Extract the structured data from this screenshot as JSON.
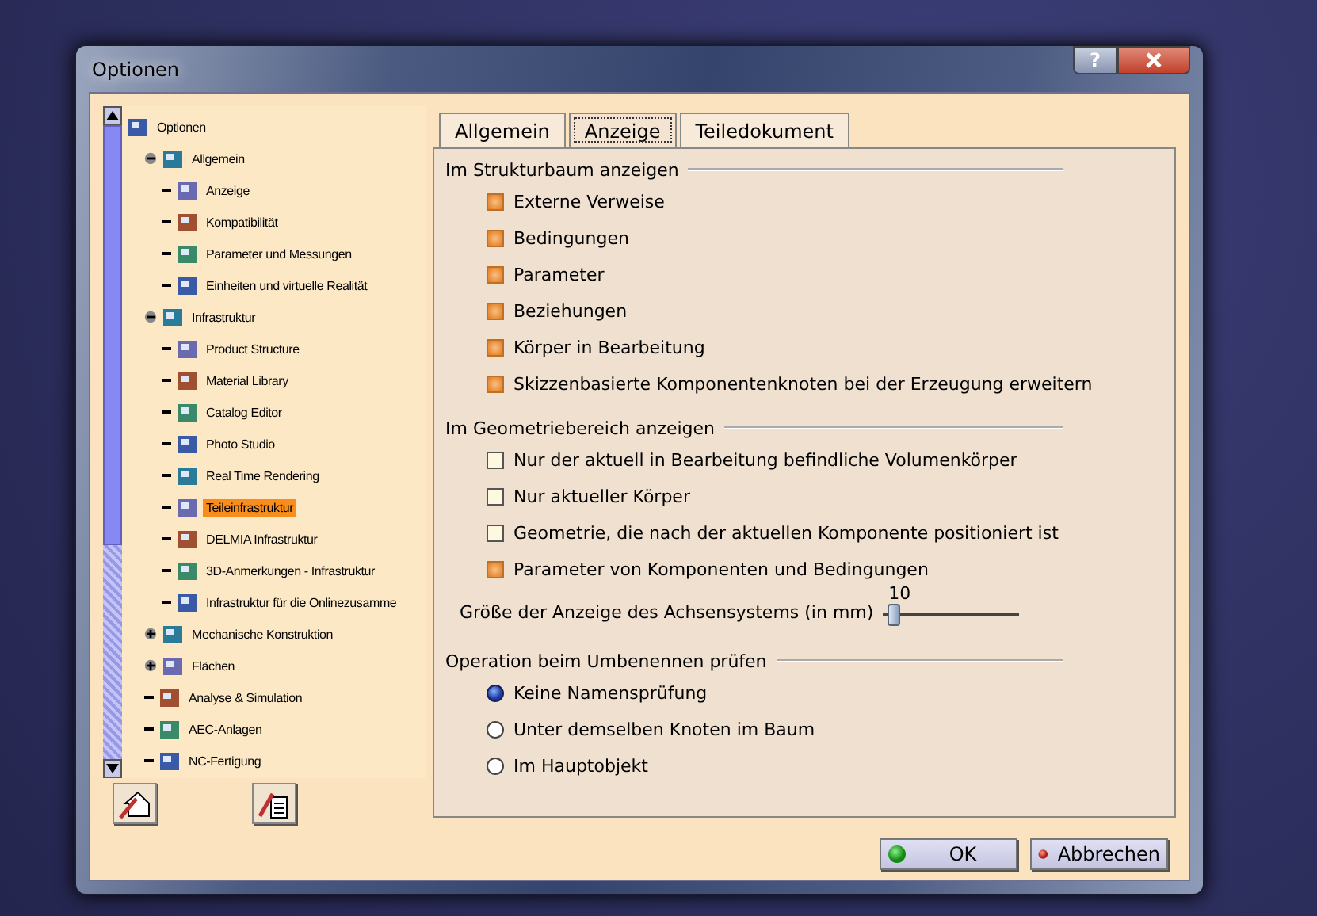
{
  "window": {
    "title": "Optionen",
    "help": "?"
  },
  "tree": {
    "items": [
      {
        "label": "Optionen",
        "selected": false,
        "children": [
          {
            "label": "Allgemein",
            "expanded": true,
            "selected": false,
            "children": [
              {
                "label": "Anzeige",
                "selected": false
              },
              {
                "label": "Kompatibilität",
                "selected": false
              },
              {
                "label": "Parameter und Messungen",
                "selected": false
              },
              {
                "label": "Einheiten und virtuelle Realität",
                "selected": false
              }
            ]
          },
          {
            "label": "Infrastruktur",
            "expanded": true,
            "selected": false,
            "children": [
              {
                "label": "Product Structure",
                "selected": false
              },
              {
                "label": "Material Library",
                "selected": false
              },
              {
                "label": "Catalog Editor",
                "selected": false
              },
              {
                "label": "Photo Studio",
                "selected": false
              },
              {
                "label": "Real Time Rendering",
                "selected": false
              },
              {
                "label": "Teileinfrastruktur",
                "selected": true
              },
              {
                "label": "DELMIA Infrastruktur",
                "selected": false
              },
              {
                "label": "3D-Anmerkungen - Infrastruktur",
                "selected": false
              },
              {
                "label": "Infrastruktur für die Onlinezusamme",
                "selected": false
              }
            ]
          },
          {
            "label": "Mechanische Konstruktion",
            "expanded": false,
            "selected": false
          },
          {
            "label": "Flächen",
            "expanded": false,
            "selected": false
          },
          {
            "label": "Analyse & Simulation",
            "selected": false
          },
          {
            "label": "AEC-Anlagen",
            "selected": false
          },
          {
            "label": "NC-Fertigung",
            "selected": false
          }
        ]
      }
    ]
  },
  "tabs": [
    {
      "label": "Allgemein",
      "selected": false
    },
    {
      "label": "Anzeige",
      "selected": true
    },
    {
      "label": "Teiledokument",
      "selected": false
    }
  ],
  "sections": [
    {
      "title": "Im Strukturbaum anzeigen",
      "rows": [
        {
          "kind": "checkbox",
          "label": "Externe Verweise",
          "checked": true
        },
        {
          "kind": "checkbox",
          "label": "Bedingungen",
          "checked": true
        },
        {
          "kind": "checkbox",
          "label": "Parameter",
          "checked": true
        },
        {
          "kind": "checkbox",
          "label": "Beziehungen",
          "checked": true
        },
        {
          "kind": "checkbox",
          "label": "Körper in Bearbeitung",
          "checked": true
        },
        {
          "kind": "checkbox",
          "label": "Skizzenbasierte Komponentenknoten bei der Erzeugung erweitern",
          "checked": true
        }
      ]
    },
    {
      "title": "Im Geometriebereich anzeigen",
      "rows": [
        {
          "kind": "checkbox",
          "label": "Nur der aktuell in Bearbeitung befindliche Volumenkörper",
          "checked": false
        },
        {
          "kind": "checkbox",
          "label": "Nur aktueller Körper",
          "checked": false
        },
        {
          "kind": "checkbox",
          "label": "Geometrie, die nach der aktuellen Komponente positioniert ist",
          "checked": false
        },
        {
          "kind": "checkbox",
          "label": "Parameter von Komponenten und Bedingungen",
          "checked": true
        },
        {
          "kind": "slider",
          "label": "Größe der Anzeige des Achsensystems (in mm)",
          "reading": "10",
          "level": 0.04
        }
      ]
    },
    {
      "title": "Operation beim Umbenennen prüfen",
      "rows": [
        {
          "kind": "radio",
          "label": "Keine Namensprüfung",
          "selected": true
        },
        {
          "kind": "radio",
          "label": "Unter demselben Knoten im Baum",
          "selected": false
        },
        {
          "kind": "radio",
          "label": "Im Hauptobjekt",
          "selected": false
        }
      ]
    }
  ],
  "buttons": [
    {
      "label": "OK",
      "kind": "ok"
    },
    {
      "label": "Abbrechen",
      "kind": "cancel"
    }
  ]
}
